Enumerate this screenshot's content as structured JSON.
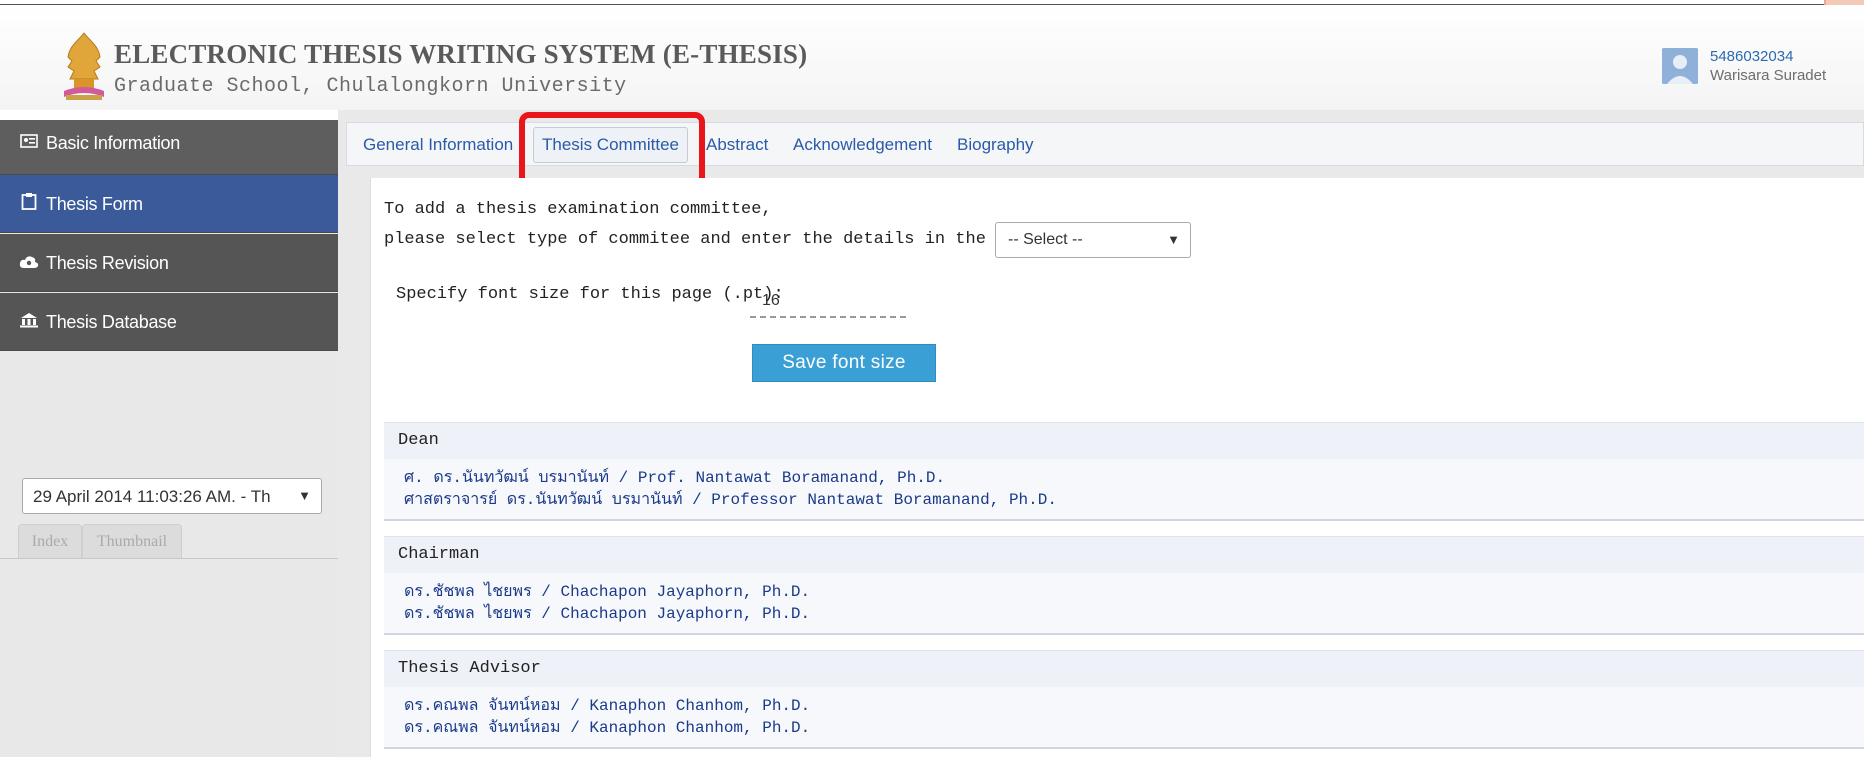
{
  "header": {
    "title": "ELECTRONIC THESIS WRITING SYSTEM (E-THESIS)",
    "subtitle": "Graduate School, Chulalongkorn University",
    "user_id": "5486032034",
    "user_name": "Warisara Suradet"
  },
  "sidebar": {
    "items": [
      {
        "label": "Basic Information",
        "icon": "id-card-icon"
      },
      {
        "label": "Thesis Form",
        "icon": "clipboard-icon"
      },
      {
        "label": "Thesis Revision",
        "icon": "cloud-icon"
      },
      {
        "label": "Thesis Database",
        "icon": "database-icon"
      }
    ],
    "date_select_value": "29 April 2014 11:03:26 AM. - Th",
    "sub_tabs": [
      "Index",
      "Thumbnail"
    ]
  },
  "tabs": [
    {
      "label": "General Information"
    },
    {
      "label": "Thesis Committee",
      "active": true
    },
    {
      "label": "Abstract"
    },
    {
      "label": "Acknowledgement"
    },
    {
      "label": "Biography"
    }
  ],
  "form": {
    "intro_line1": "To add a thesis examination committee,",
    "intro_line2": "please select type of commitee and enter the details in the form:",
    "type_select_value": "-- Select --",
    "font_label": "Specify font size for this page (.pt):",
    "font_value": "16",
    "save_button": "Save font size"
  },
  "committee": [
    {
      "role": "Dean",
      "lines": [
        "ศ. ดร.นันทวัฒน์ บรมานันท์ / Prof. Nantawat Boramanand, Ph.D.",
        "ศาสตราจารย์ ดร.นันทวัฒน์ บรมานันท์ / Professor Nantawat Boramanand, Ph.D."
      ]
    },
    {
      "role": "Chairman",
      "lines": [
        "ดร.ชัชพล ไชยพร / Chachapon Jayaphorn, Ph.D.",
        "ดร.ชัชพล ไชยพร / Chachapon Jayaphorn, Ph.D."
      ]
    },
    {
      "role": "Thesis Advisor",
      "lines": [
        "ดร.คณพล จันทน์หอม / Kanaphon Chanhom, Ph.D.",
        "ดร.คณพล จันทน์หอม / Kanaphon Chanhom, Ph.D."
      ]
    }
  ],
  "colors": {
    "nav_active": "#3b5a9a",
    "nav_default": "#555555",
    "link": "#2a5aa8",
    "button": "#3a9fd5",
    "highlight": "#e8151b"
  }
}
